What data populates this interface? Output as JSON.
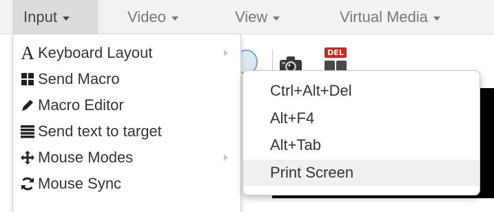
{
  "menubar": {
    "items": [
      {
        "label": "Input",
        "active": true
      },
      {
        "label": "Video"
      },
      {
        "label": "View"
      },
      {
        "label": "Virtual Media"
      }
    ]
  },
  "input_menu": {
    "items": [
      {
        "label": "Keyboard Layout",
        "icon": "font-letter-a-icon",
        "has_submenu": true
      },
      {
        "label": "Send Macro",
        "icon": "grid-squares-icon",
        "has_submenu": false
      },
      {
        "label": "Macro Editor",
        "icon": "pencil-icon",
        "has_submenu": false
      },
      {
        "label": "Send text to target",
        "icon": "list-lines-icon",
        "has_submenu": false
      },
      {
        "label": "Mouse Modes",
        "icon": "move-arrows-icon",
        "has_submenu": true
      },
      {
        "label": "Mouse Sync",
        "icon": "refresh-icon",
        "has_submenu": false
      }
    ]
  },
  "macro_submenu": {
    "items": [
      {
        "label": "Ctrl+Alt+Del"
      },
      {
        "label": "Alt+F4"
      },
      {
        "label": "Alt+Tab"
      },
      {
        "label": "Print Screen",
        "highlighted": true
      }
    ]
  },
  "toolbar": {
    "del_icon_text": "DEL",
    "icons": [
      "partial-round-icon",
      "camera-icon",
      "ctrl-alt-del-icon"
    ]
  },
  "colors": {
    "menubar_bg": "#f2f2f2",
    "menubar_active_bg": "#dcdcdc",
    "menu_text": "#333333",
    "menubar_text": "#777777",
    "highlight_bg": "#f0f0f0",
    "screen_bg": "#000000",
    "del_red": "#e0201b"
  }
}
